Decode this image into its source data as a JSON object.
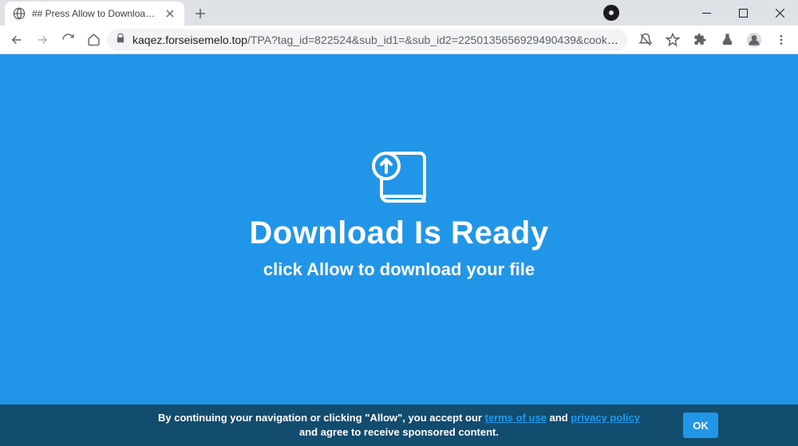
{
  "window": {
    "tab_title": "## Press Allow to Download ##",
    "url_origin": "kaqez.forseisemelo.top",
    "url_path": "/TPA?tag_id=822524&sub_id1=&sub_id2=2250135656929490439&cookie_id=f68899b4-bef3-4520-a9e..."
  },
  "page": {
    "heading": "Download Is Ready",
    "subheading": "click Allow to download your file"
  },
  "cookie": {
    "pre": "By continuing your navigation or clicking \"Allow\", you accept our ",
    "link1": "terms of use",
    "mid": " and ",
    "link2": "privacy policy",
    "post": " and agree to receive sponsored content.",
    "ok": "OK"
  }
}
